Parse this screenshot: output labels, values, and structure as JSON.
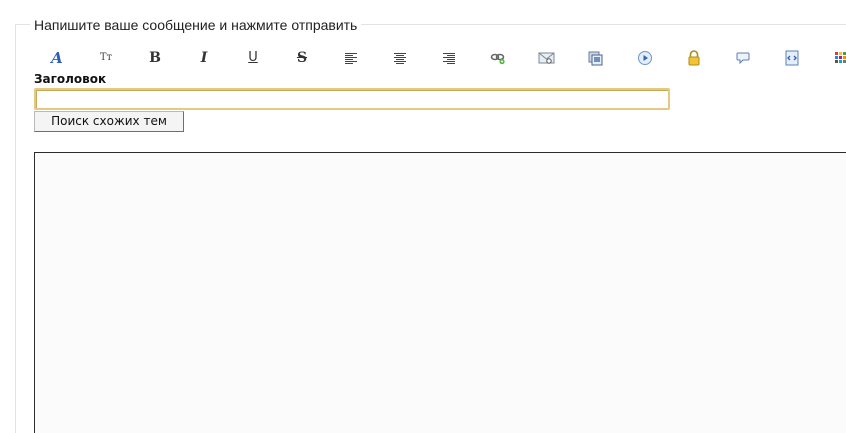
{
  "form": {
    "legend": "Напишите ваше сообщение и нажмите отправить",
    "title_label": "Заголовок",
    "title_value": "",
    "search_button_label": "Поиск схожих тем",
    "message_value": ""
  },
  "toolbar": {
    "items": [
      {
        "name": "font-face",
        "glyph": "A",
        "icon": "font-face-icon"
      },
      {
        "name": "font-size",
        "glyph": "Tт",
        "icon": "font-size-icon"
      },
      {
        "name": "bold",
        "glyph": "B",
        "icon": "bold-icon"
      },
      {
        "name": "italic",
        "glyph": "I",
        "icon": "italic-icon"
      },
      {
        "name": "underline",
        "glyph": "U",
        "icon": "underline-icon"
      },
      {
        "name": "strikethrough",
        "glyph": "S",
        "icon": "strikethrough-icon"
      },
      {
        "name": "align-left",
        "icon": "align-left-icon"
      },
      {
        "name": "align-center",
        "icon": "align-center-icon"
      },
      {
        "name": "align-right",
        "icon": "align-right-icon"
      },
      {
        "name": "link",
        "icon": "link-icon"
      },
      {
        "name": "email",
        "icon": "email-icon"
      },
      {
        "name": "image",
        "icon": "image-icon"
      },
      {
        "name": "video",
        "icon": "video-icon"
      },
      {
        "name": "hide",
        "icon": "lock-icon"
      },
      {
        "name": "quote",
        "icon": "speech-bubble-icon"
      },
      {
        "name": "code",
        "icon": "code-icon"
      },
      {
        "name": "color",
        "icon": "color-palette-icon"
      }
    ]
  },
  "colors": {
    "input_border": "#e4c982",
    "textarea_border": "#2b2b2b",
    "textarea_bg": "#fbfbfb",
    "glyph_blue": "#2d5fb8"
  }
}
